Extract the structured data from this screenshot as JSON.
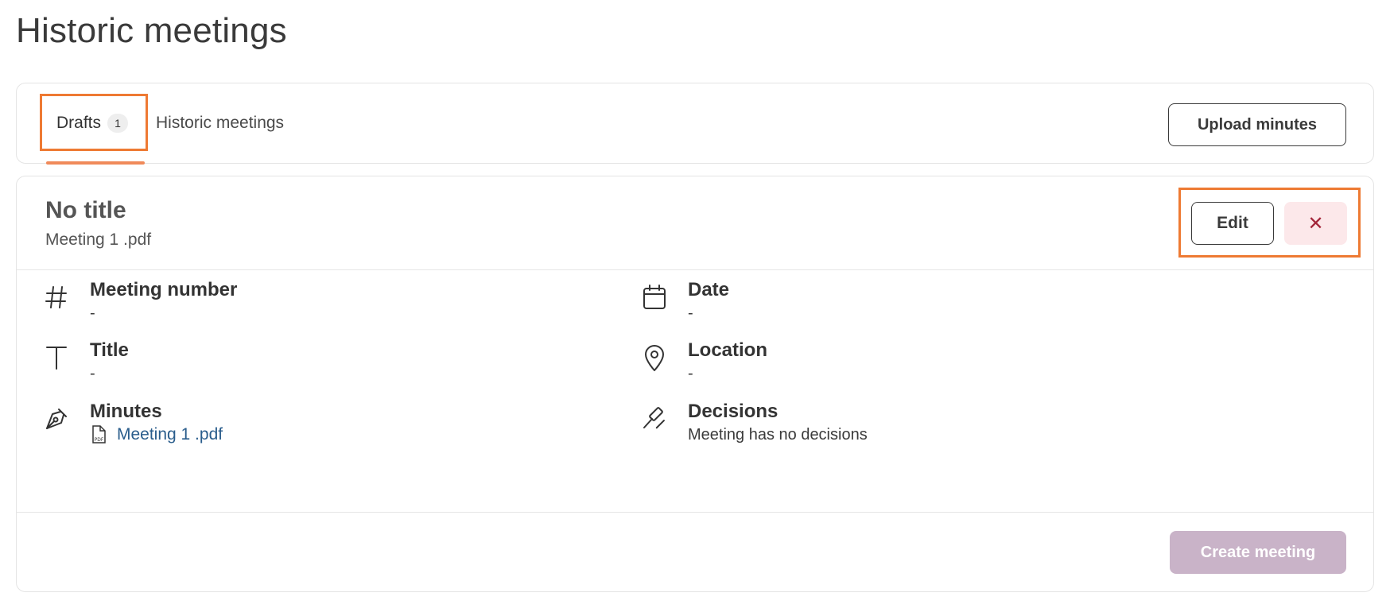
{
  "page": {
    "title": "Historic meetings"
  },
  "tabs": {
    "drafts": {
      "label": "Drafts",
      "count": "1"
    },
    "historic": {
      "label": "Historic meetings"
    },
    "upload_label": "Upload minutes"
  },
  "draft": {
    "title": "No title",
    "file_name": "Meeting 1 .pdf",
    "edit_label": "Edit",
    "delete_symbol": "✕",
    "fields": {
      "meeting_number": {
        "label": "Meeting number",
        "value": "-"
      },
      "date": {
        "label": "Date",
        "value": "-"
      },
      "title": {
        "label": "Title",
        "value": "-"
      },
      "location": {
        "label": "Location",
        "value": "-"
      },
      "minutes": {
        "label": "Minutes",
        "file": "Meeting 1 .pdf",
        "file_icon_text": "PDF"
      },
      "decisions": {
        "label": "Decisions",
        "value": "Meeting has no decisions"
      }
    },
    "create_label": "Create meeting"
  },
  "colors": {
    "accent_highlight": "#ee7a33",
    "tab_underline": "#f08a5a",
    "link": "#2a5d8c",
    "delete_bg": "#fce8ea",
    "delete_fg": "#a3263a",
    "create_disabled_bg": "#c9b3c8"
  },
  "icons": {
    "meeting_number": "hash-icon",
    "date": "calendar-icon",
    "title": "text-icon",
    "location": "map-pin-icon",
    "minutes": "pen-nib-icon",
    "decisions": "gavel-icon",
    "minutes_file": "pdf-file-icon",
    "delete": "close-icon"
  }
}
